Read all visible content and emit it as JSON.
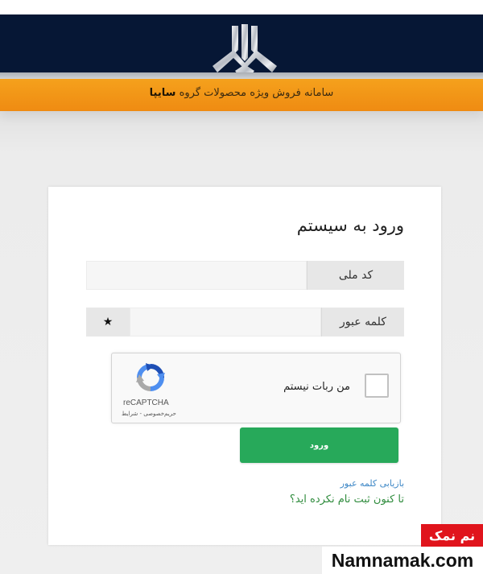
{
  "header": {
    "logo_icon": "saipa-logo-icon",
    "subtitle_prefix": "سامانه فروش ویژه محصولات گروه",
    "subtitle_brand": "سایپا",
    "colors": {
      "dark": "#061735",
      "orange": "#f39617"
    }
  },
  "login": {
    "title": "ورود به سیستم",
    "national_code_label": "کد ملی",
    "national_code_value": "",
    "password_label": "کلمه عبور",
    "password_value": "",
    "password_icon": "star-icon",
    "password_icon_glyph": "★",
    "captcha": {
      "checkbox_label": "من ربات نیستم",
      "brand": "reCAPTCHA",
      "links": "حریم‌خصوصی - شرایط",
      "icon": "recaptcha-icon"
    },
    "submit_label": "ورود",
    "submit_color": "#27a95a",
    "recover_link": "بازیابی کلمه عبور",
    "register_link": "تا کنون ثبت نام نکرده اید؟"
  },
  "watermark": {
    "persian": "نم نمک",
    "site": "Namnamak.com"
  }
}
